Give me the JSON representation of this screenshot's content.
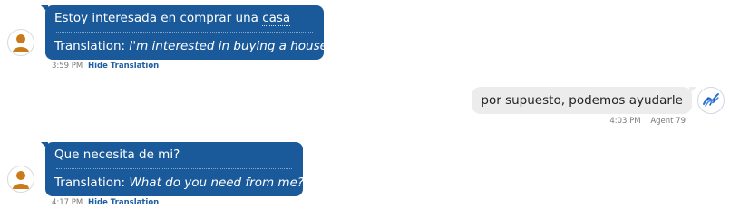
{
  "messages": [
    {
      "original_prefix": "Estoy interesada en comprar una ",
      "original_highlight": "casa",
      "translation_label": "Translation:",
      "translation_text": "I'm interested in buying a house.",
      "time": "3:59 PM",
      "hide_label": "Hide Translation"
    },
    {
      "text": "por supuesto, podemos ayudarle",
      "time": "4:03 PM",
      "agent": "Agent 79"
    },
    {
      "original": "Que necesita de mi?",
      "translation_label": "Translation:",
      "translation_text": "What do you need from me?",
      "time": "4:17 PM",
      "hide_label": "Hide Translation"
    }
  ],
  "colors": {
    "customer_bubble": "#1b5a9a",
    "agent_bubble": "#ececec",
    "user_icon": "#c97a1a",
    "link": "#1d5fa3"
  },
  "icons": {
    "customer_avatar": "user-icon",
    "agent_avatar": "agent-logo-icon"
  }
}
